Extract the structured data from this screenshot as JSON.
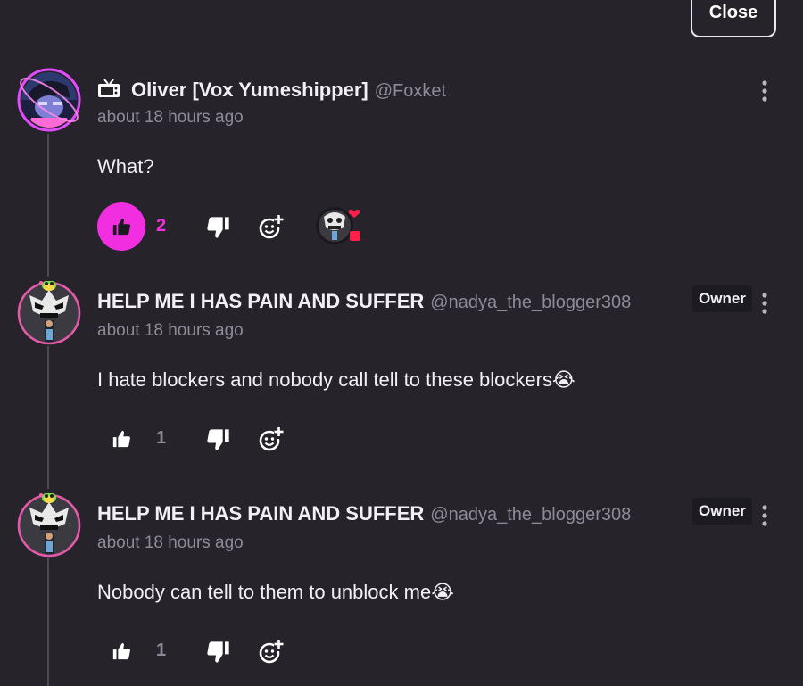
{
  "close_label": "Close",
  "comments": [
    {
      "name": "Oliver [Vox Yumeshipper]",
      "handle": "@Foxket",
      "time": "about 18 hours ago",
      "text": "What?",
      "likes": "2",
      "liked": true,
      "name_icon": "tv-icon",
      "owner": false
    },
    {
      "name": "HELP ME I HAS PAIN AND SUFFER",
      "handle": "@nadya_the_blogger308",
      "time": "about 18 hours ago",
      "text": "I hate blockers and nobody call tell to these blockers😭",
      "likes": "1",
      "liked": false,
      "owner": true,
      "owner_label": "Owner"
    },
    {
      "name": "HELP ME I HAS PAIN AND SUFFER",
      "handle": "@nadya_the_blogger308",
      "time": "about 18 hours ago",
      "text": "Nobody can tell to them to unblock me😭",
      "likes": "1",
      "liked": false,
      "owner": true,
      "owner_label": "Owner"
    }
  ],
  "colors": {
    "background": "#26232b",
    "accent_like": "#f12fe1",
    "muted_text": "#8e8a97",
    "owner_badge_bg": "#1d1b22"
  }
}
